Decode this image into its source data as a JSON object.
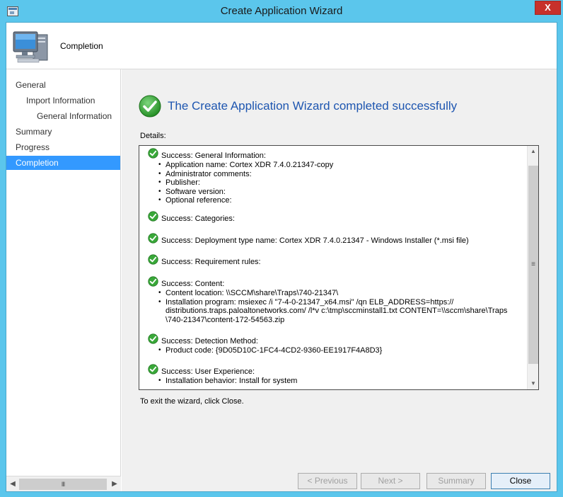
{
  "window": {
    "title": "Create Application Wizard",
    "close_glyph": "X"
  },
  "header": {
    "title": "Completion",
    "icon": "computer-icon"
  },
  "nav": {
    "items": [
      {
        "label": "General",
        "indent": 0,
        "selected": false
      },
      {
        "label": "Import Information",
        "indent": 1,
        "selected": false
      },
      {
        "label": "General Information",
        "indent": 2,
        "selected": false
      },
      {
        "label": "Summary",
        "indent": 0,
        "selected": false
      },
      {
        "label": "Progress",
        "indent": 0,
        "selected": false
      },
      {
        "label": "Completion",
        "indent": 0,
        "selected": true
      }
    ],
    "scroll_thumb_glyph": "III"
  },
  "main": {
    "heading": "The Create Application Wizard completed successfully",
    "details_label": "Details:",
    "exit_text": "To exit the wizard, click Close."
  },
  "details": {
    "sections": [
      {
        "title": "Success: General Information:",
        "bullets": [
          [
            "Application name: Cortex XDR 7.4.0.21347-copy"
          ],
          [
            "Administrator comments:"
          ],
          [
            "Publisher:"
          ],
          [
            "Software version:"
          ],
          [
            "Optional reference:"
          ]
        ]
      },
      {
        "title": "Success: Categories:",
        "bullets": []
      },
      {
        "title": "Success: Deployment type name: Cortex XDR 7.4.0.21347 - Windows Installer (*.msi file)",
        "bullets": []
      },
      {
        "title": "Success: Requirement rules:",
        "bullets": []
      },
      {
        "title": "Success: Content:",
        "bullets": [
          [
            "Content location: \\\\SCCM\\share\\Traps\\740-21347\\"
          ],
          [
            "Installation program: msiexec /i \"7-4-0-21347_x64.msi\" /qn ELB_ADDRESS=https://",
            "distributions.traps.paloaltonetworks.com/  /l*v c:\\tmp\\sccminstall1.txt  CONTENT=\\\\sccm\\share\\Traps",
            "\\740-21347\\content-172-54563.zip"
          ]
        ]
      },
      {
        "title": "Success: Detection Method:",
        "bullets": [
          [
            "Product code: {9D05D10C-1FC4-4CD2-9360-EE1917F4A8D3}"
          ]
        ]
      },
      {
        "title": "Success: User Experience:",
        "bullets": [
          [
            "Installation behavior: Install for system"
          ]
        ]
      }
    ],
    "scroll_thumb_glyph": "≡"
  },
  "buttons": {
    "previous": "< Previous",
    "next": "Next >",
    "summary": "Summary",
    "close": "Close"
  },
  "colors": {
    "title_bar": "#5bc6ec",
    "heading": "#1e56b0",
    "nav_selected": "#3399ff",
    "close_button": "#c7312b",
    "success_green": "#2f9e2f"
  }
}
